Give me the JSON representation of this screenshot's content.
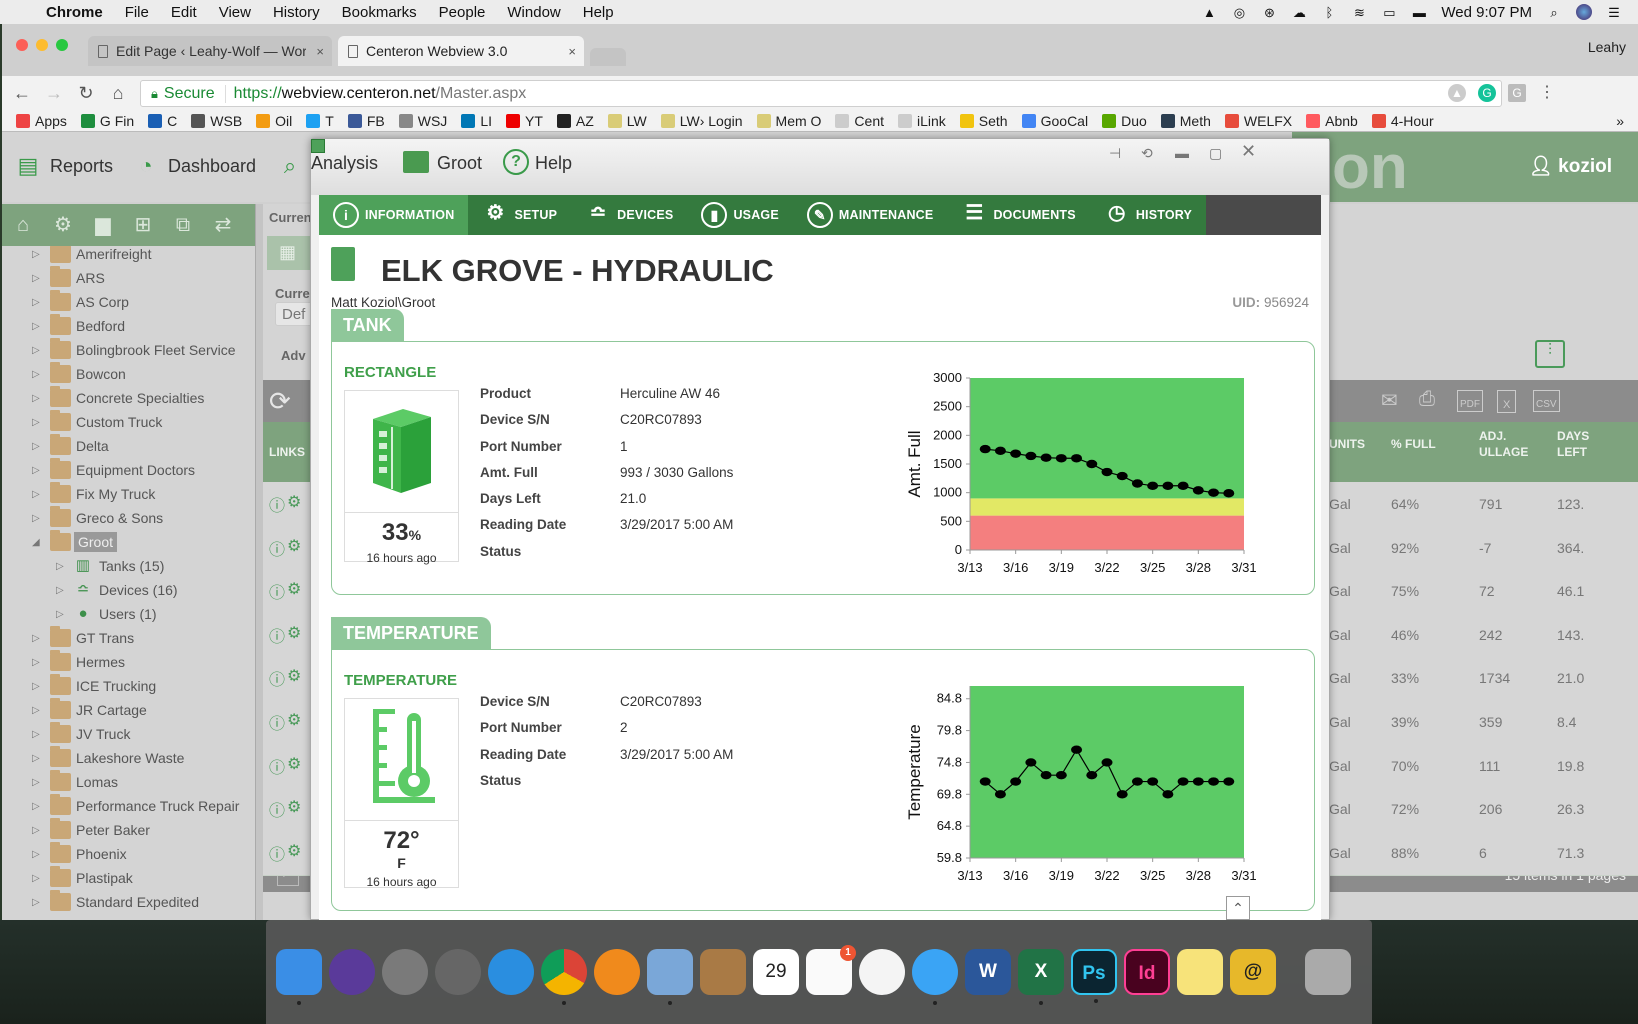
{
  "menubar": {
    "app": "Chrome",
    "items": [
      "File",
      "Edit",
      "View",
      "History",
      "Bookmarks",
      "People",
      "Window",
      "Help"
    ],
    "clock": "Wed 9:07 PM"
  },
  "browser": {
    "tabs": [
      {
        "title": "Edit Page ‹ Leahy-Wolf — Wor",
        "active": false
      },
      {
        "title": "Centeron Webview 3.0",
        "active": true
      }
    ],
    "profile": "Leahy",
    "secure_label": "Secure",
    "url_scheme": "https://",
    "url_domain": "webview.centeron.net",
    "url_path": "/Master.aspx",
    "bookmarks": [
      {
        "label": "Apps",
        "color": "#e44"
      },
      {
        "label": "G Fin",
        "color": "#1e8e3e"
      },
      {
        "label": "C",
        "color": "#1a5fb4"
      },
      {
        "label": "WSB",
        "color": "#555"
      },
      {
        "label": "Oil",
        "color": "#f39c12"
      },
      {
        "label": "T",
        "color": "#1da1f2"
      },
      {
        "label": "FB",
        "color": "#3b5998"
      },
      {
        "label": "WSJ",
        "color": "#888"
      },
      {
        "label": "LI",
        "color": "#0077b5"
      },
      {
        "label": "YT",
        "color": "#e00"
      },
      {
        "label": "AZ",
        "color": "#222"
      },
      {
        "label": "LW",
        "color": "#d9cc77"
      },
      {
        "label": "LW› Login",
        "color": "#d9cc77"
      },
      {
        "label": "Mem O",
        "color": "#d9cc77"
      },
      {
        "label": "Cent",
        "color": "#ccc"
      },
      {
        "label": "iLink",
        "color": "#ccc"
      },
      {
        "label": "Seth",
        "color": "#f1c40f"
      },
      {
        "label": "GooCal",
        "color": "#4285f4"
      },
      {
        "label": "Duo",
        "color": "#58a700"
      },
      {
        "label": "Meth",
        "color": "#2c3e50"
      },
      {
        "label": "WELFX",
        "color": "#e74c3c"
      },
      {
        "label": "Abnb",
        "color": "#ff5a5f"
      },
      {
        "label": "4-Hour",
        "color": "#e74c3c"
      }
    ]
  },
  "app": {
    "nav": [
      {
        "label": "Reports",
        "icon": "reports-icon"
      },
      {
        "label": "Dashboard",
        "icon": "dashboard-icon"
      },
      {
        "label": "Analysis",
        "icon": "analysis-icon"
      },
      {
        "label": "Groot",
        "icon": "folder-icon"
      },
      {
        "label": "Help",
        "icon": "help-icon"
      }
    ],
    "user": "koziol",
    "brand_fragment": "on",
    "tree": [
      {
        "label": "Amerifreight"
      },
      {
        "label": "ARS"
      },
      {
        "label": "AS Corp"
      },
      {
        "label": "Bedford"
      },
      {
        "label": "Bolingbrook Fleet Service"
      },
      {
        "label": "Bowcon"
      },
      {
        "label": "Concrete Specialties"
      },
      {
        "label": "Custom Truck"
      },
      {
        "label": "Delta"
      },
      {
        "label": "Equipment Doctors"
      },
      {
        "label": "Fix My Truck"
      },
      {
        "label": "Greco & Sons"
      },
      {
        "label": "Groot",
        "selected": true,
        "expanded": true
      },
      {
        "label": "Tanks (15)",
        "sub": true,
        "icon": "tank-icon"
      },
      {
        "label": "Devices (16)",
        "sub": true,
        "icon": "router-icon"
      },
      {
        "label": "Users (1)",
        "sub": true,
        "icon": "user-icon"
      },
      {
        "label": "GT Trans"
      },
      {
        "label": "Hermes"
      },
      {
        "label": "ICE Trucking"
      },
      {
        "label": "JR Cartage"
      },
      {
        "label": "JV Truck"
      },
      {
        "label": "Lakeshore Waste"
      },
      {
        "label": "Lomas"
      },
      {
        "label": "Performance Truck Repair"
      },
      {
        "label": "Peter Baker"
      },
      {
        "label": "Phoenix"
      },
      {
        "label": "Plastipak"
      },
      {
        "label": "Standard Expedited"
      }
    ],
    "grid": {
      "partial_labels": {
        "current": "Curren",
        "current2": "Curre",
        "default": "Def",
        "advanced": "Adv",
        "links": "LINKS"
      },
      "headers": [
        "FULL",
        "UNITS",
        "% FULL",
        "ADJ. ULLAGE",
        "DAYS LEFT"
      ],
      "rows": [
        {
          "units": "Gal",
          "pct": "64%",
          "ullage": "791",
          "days": "123."
        },
        {
          "units": "Gal",
          "pct": "92%",
          "ullage": "-7",
          "days": "364."
        },
        {
          "units": "Gal",
          "pct": "75%",
          "ullage": "72",
          "days": "46.1"
        },
        {
          "units": "Gal",
          "pct": "46%",
          "ullage": "242",
          "days": "143."
        },
        {
          "units": "Gal",
          "pct": "33%",
          "ullage": "1734",
          "days": "21.0"
        },
        {
          "units": "Gal",
          "pct": "39%",
          "ullage": "359",
          "days": "8.4"
        },
        {
          "units": "Gal",
          "pct": "70%",
          "ullage": "111",
          "days": "19.8"
        },
        {
          "units": "Gal",
          "pct": "72%",
          "ullage": "206",
          "days": "26.3"
        },
        {
          "units": "Gal",
          "pct": "88%",
          "ullage": "6",
          "days": "71.3"
        }
      ],
      "footer": "15 items in 1 pages",
      "export_labels": [
        "PDF",
        "X",
        "CSV"
      ]
    }
  },
  "modal": {
    "tabs": [
      {
        "label": "INFORMATION",
        "icon": "info-icon",
        "active": true
      },
      {
        "label": "SETUP",
        "icon": "gear-icon"
      },
      {
        "label": "DEVICES",
        "icon": "router-icon"
      },
      {
        "label": "USAGE",
        "icon": "usage-icon"
      },
      {
        "label": "MAINTENANCE",
        "icon": "wrench-icon"
      },
      {
        "label": "DOCUMENTS",
        "icon": "clipboard-icon"
      },
      {
        "label": "HISTORY",
        "icon": "history-icon"
      }
    ],
    "title": "ELK GROVE - HYDRAULIC",
    "path": "Matt Koziol\\Groot",
    "uid_label": "UID:",
    "uid": "956924",
    "tank": {
      "section": "TANK",
      "shape": "RECTANGLE",
      "percent": "33",
      "percent_suffix": "%",
      "ago": "16 hours ago",
      "fields": [
        {
          "k": "Product",
          "v": "Herculine AW 46"
        },
        {
          "k": "Device S/N",
          "v": "C20RC07893"
        },
        {
          "k": "Port Number",
          "v": "1"
        },
        {
          "k": "Amt. Full",
          "v": "993 / 3030 Gallons"
        },
        {
          "k": "Days Left",
          "v": "21.0"
        },
        {
          "k": "Reading Date",
          "v": "3/29/2017 5:00 AM"
        },
        {
          "k": "Status",
          "v": ""
        }
      ]
    },
    "temperature": {
      "section": "TEMPERATURE",
      "subtitle": "TEMPERATURE",
      "value": "72°",
      "unit": "F",
      "ago": "16 hours ago",
      "fields": [
        {
          "k": "Device S/N",
          "v": "C20RC07893"
        },
        {
          "k": "Port Number",
          "v": "2"
        },
        {
          "k": "Reading Date",
          "v": "3/29/2017 5:00 AM"
        },
        {
          "k": "Status",
          "v": ""
        }
      ]
    }
  },
  "chart_data": [
    {
      "type": "line",
      "title": "",
      "xlabel": "",
      "ylabel": "Amt. Full",
      "xticks": [
        "3/13",
        "3/16",
        "3/19",
        "3/22",
        "3/25",
        "3/28",
        "3/31"
      ],
      "xlim_days": [
        0,
        18
      ],
      "ylim": [
        0,
        3000
      ],
      "yticks": [
        0,
        500,
        1000,
        1500,
        2000,
        2500,
        3000
      ],
      "bands": [
        {
          "from": 0,
          "to": 600,
          "color": "#f47f7f"
        },
        {
          "from": 600,
          "to": 900,
          "color": "#e2e865"
        },
        {
          "from": 900,
          "to": 3000,
          "color": "#5ccb66"
        }
      ],
      "x_days": [
        1,
        2,
        3,
        4,
        5,
        6,
        7,
        8,
        9,
        10,
        11,
        12,
        13,
        14,
        15,
        16,
        17
      ],
      "values": [
        1760,
        1730,
        1680,
        1640,
        1610,
        1600,
        1600,
        1500,
        1360,
        1290,
        1160,
        1120,
        1120,
        1120,
        1040,
        1000,
        990
      ]
    },
    {
      "type": "line",
      "title": "",
      "xlabel": "",
      "ylabel": "Temperature",
      "xticks": [
        "3/13",
        "3/16",
        "3/19",
        "3/22",
        "3/25",
        "3/28",
        "3/31"
      ],
      "xlim_days": [
        0,
        18
      ],
      "ylim": [
        59.8,
        86.8
      ],
      "yticks": [
        59.8,
        64.8,
        69.8,
        74.8,
        79.8,
        84.8
      ],
      "bands": [
        {
          "from": 59.8,
          "to": 86.8,
          "color": "#5ccb66"
        }
      ],
      "x_days": [
        1,
        2,
        3,
        4,
        5,
        6,
        7,
        8,
        9,
        10,
        11,
        12,
        13,
        14,
        15,
        16,
        17
      ],
      "values": [
        71.8,
        69.8,
        71.8,
        74.8,
        72.8,
        72.8,
        76.8,
        72.8,
        74.8,
        69.8,
        71.8,
        71.8,
        69.8,
        71.8,
        71.8,
        71.8,
        71.8
      ]
    }
  ],
  "dock": [
    {
      "name": "Finder",
      "color": "#3a8ee6",
      "dot": true
    },
    {
      "name": "Siri",
      "color": "#5a3a9a"
    },
    {
      "name": "Launchpad",
      "color": "#7a7a7a"
    },
    {
      "name": "System Preferences",
      "color": "#666"
    },
    {
      "name": "Safari",
      "color": "#2a8ee0"
    },
    {
      "name": "Chrome",
      "color": "#4285f4",
      "dot": true
    },
    {
      "name": "iBooks",
      "color": "#f08a1c"
    },
    {
      "name": "Preview",
      "color": "#7aa7d8",
      "dot": true
    },
    {
      "name": "Contacts",
      "color": "#a97a45"
    },
    {
      "name": "Calendar",
      "color": "#fff",
      "text": "29"
    },
    {
      "name": "Reminders",
      "color": "#fafafa",
      "badge": "1"
    },
    {
      "name": "Photos",
      "color": "#f4f4f4"
    },
    {
      "name": "Messages",
      "color": "#3aa4f5",
      "dot": true
    },
    {
      "name": "Word",
      "color": "#2b579a",
      "text": "W"
    },
    {
      "name": "Excel",
      "color": "#217346",
      "text": "X",
      "dot": true
    },
    {
      "name": "Photoshop",
      "color": "#0b2531",
      "text": "Ps",
      "dot": true
    },
    {
      "name": "InDesign",
      "color": "#49021f",
      "text": "Id"
    },
    {
      "name": "Notes",
      "color": "#f7e37a"
    },
    {
      "name": "Mail Lock",
      "color": "#e7b82a",
      "text": "@"
    },
    {
      "name": "Trash",
      "color": "#aaa"
    }
  ]
}
